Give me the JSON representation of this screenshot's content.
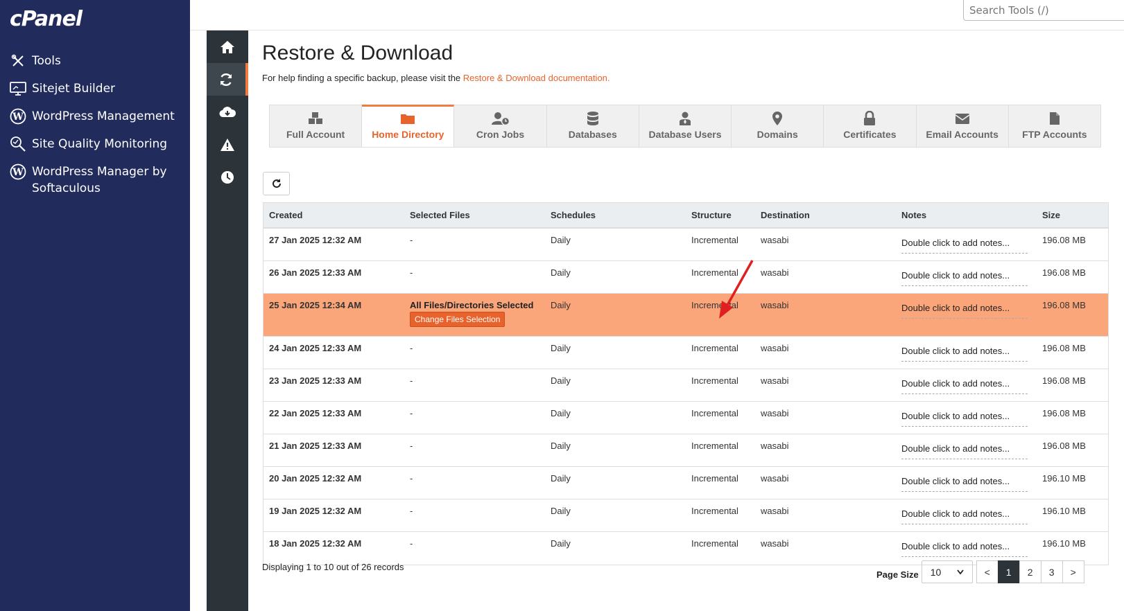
{
  "brand": {
    "logo": "cPanel"
  },
  "search": {
    "placeholder": "Search Tools (/)"
  },
  "sidebar": {
    "items": [
      {
        "label": "Tools",
        "icon": "tools-icon"
      },
      {
        "label": "Sitejet Builder",
        "icon": "monitor-icon"
      },
      {
        "label": "WordPress Management",
        "icon": "wordpress-icon"
      },
      {
        "label": "Site Quality Monitoring",
        "icon": "magnifier-icon"
      },
      {
        "label": "WordPress Manager by Softaculous",
        "icon": "wordpress-icon"
      }
    ]
  },
  "rail": [
    "home-icon",
    "sync-icon",
    "cloud-download-icon",
    "warning-icon",
    "clock-icon"
  ],
  "page": {
    "title": "Restore & Download",
    "help_text": "For help finding a specific backup, please visit the ",
    "help_link": "Restore & Download documentation."
  },
  "tabs": [
    {
      "label": "Full Account",
      "icon": "cubes-icon"
    },
    {
      "label": "Home Directory",
      "icon": "folder-icon",
      "active": true
    },
    {
      "label": "Cron Jobs",
      "icon": "user-clock-icon"
    },
    {
      "label": "Databases",
      "icon": "database-icon"
    },
    {
      "label": "Database Users",
      "icon": "users-icon"
    },
    {
      "label": "Domains",
      "icon": "map-pin-icon"
    },
    {
      "label": "Certificates",
      "icon": "lock-icon"
    },
    {
      "label": "Email Accounts",
      "icon": "envelope-icon"
    },
    {
      "label": "FTP Accounts",
      "icon": "file-icon"
    }
  ],
  "table": {
    "headers": [
      "Created",
      "Selected Files",
      "Schedules",
      "Structure",
      "Destination",
      "Notes",
      "Size"
    ],
    "notes_placeholder": "Double click to add notes...",
    "selected_files_label": "All Files/Directories Selected",
    "change_button": "Change Files Selection",
    "rows": [
      {
        "created": "27 Jan 2025 12:32 AM",
        "files": "-",
        "schedule": "Daily",
        "structure": "Incremental",
        "destination": "wasabi",
        "size": "196.08 MB"
      },
      {
        "created": "26 Jan 2025 12:33 AM",
        "files": "-",
        "schedule": "Daily",
        "structure": "Incremental",
        "destination": "wasabi",
        "size": "196.08 MB"
      },
      {
        "created": "25 Jan 2025 12:34 AM",
        "files": "",
        "schedule": "Daily",
        "structure": "Incremental",
        "destination": "wasabi",
        "size": "196.08 MB",
        "selected": true
      },
      {
        "created": "24 Jan 2025 12:33 AM",
        "files": "-",
        "schedule": "Daily",
        "structure": "Incremental",
        "destination": "wasabi",
        "size": "196.08 MB"
      },
      {
        "created": "23 Jan 2025 12:33 AM",
        "files": "-",
        "schedule": "Daily",
        "structure": "Incremental",
        "destination": "wasabi",
        "size": "196.08 MB"
      },
      {
        "created": "22 Jan 2025 12:33 AM",
        "files": "-",
        "schedule": "Daily",
        "structure": "Incremental",
        "destination": "wasabi",
        "size": "196.08 MB"
      },
      {
        "created": "21 Jan 2025 12:33 AM",
        "files": "-",
        "schedule": "Daily",
        "structure": "Incremental",
        "destination": "wasabi",
        "size": "196.08 MB"
      },
      {
        "created": "20 Jan 2025 12:32 AM",
        "files": "-",
        "schedule": "Daily",
        "structure": "Incremental",
        "destination": "wasabi",
        "size": "196.10 MB"
      },
      {
        "created": "19 Jan 2025 12:32 AM",
        "files": "-",
        "schedule": "Daily",
        "structure": "Incremental",
        "destination": "wasabi",
        "size": "196.10 MB"
      },
      {
        "created": "18 Jan 2025 12:32 AM",
        "files": "-",
        "schedule": "Daily",
        "structure": "Incremental",
        "destination": "wasabi",
        "size": "196.10 MB"
      }
    ]
  },
  "footer": {
    "records_text": "Displaying 1 to 10 out of 26 records",
    "page_size_label": "Page Size",
    "page_size_value": "10",
    "prev": "<",
    "next": ">",
    "pages": [
      "1",
      "2",
      "3"
    ],
    "current_page": "1"
  },
  "colors": {
    "sidebar": "#212b5c",
    "accent": "#e8632b",
    "selected_row": "#fba57a",
    "rail": "#2c3439"
  }
}
